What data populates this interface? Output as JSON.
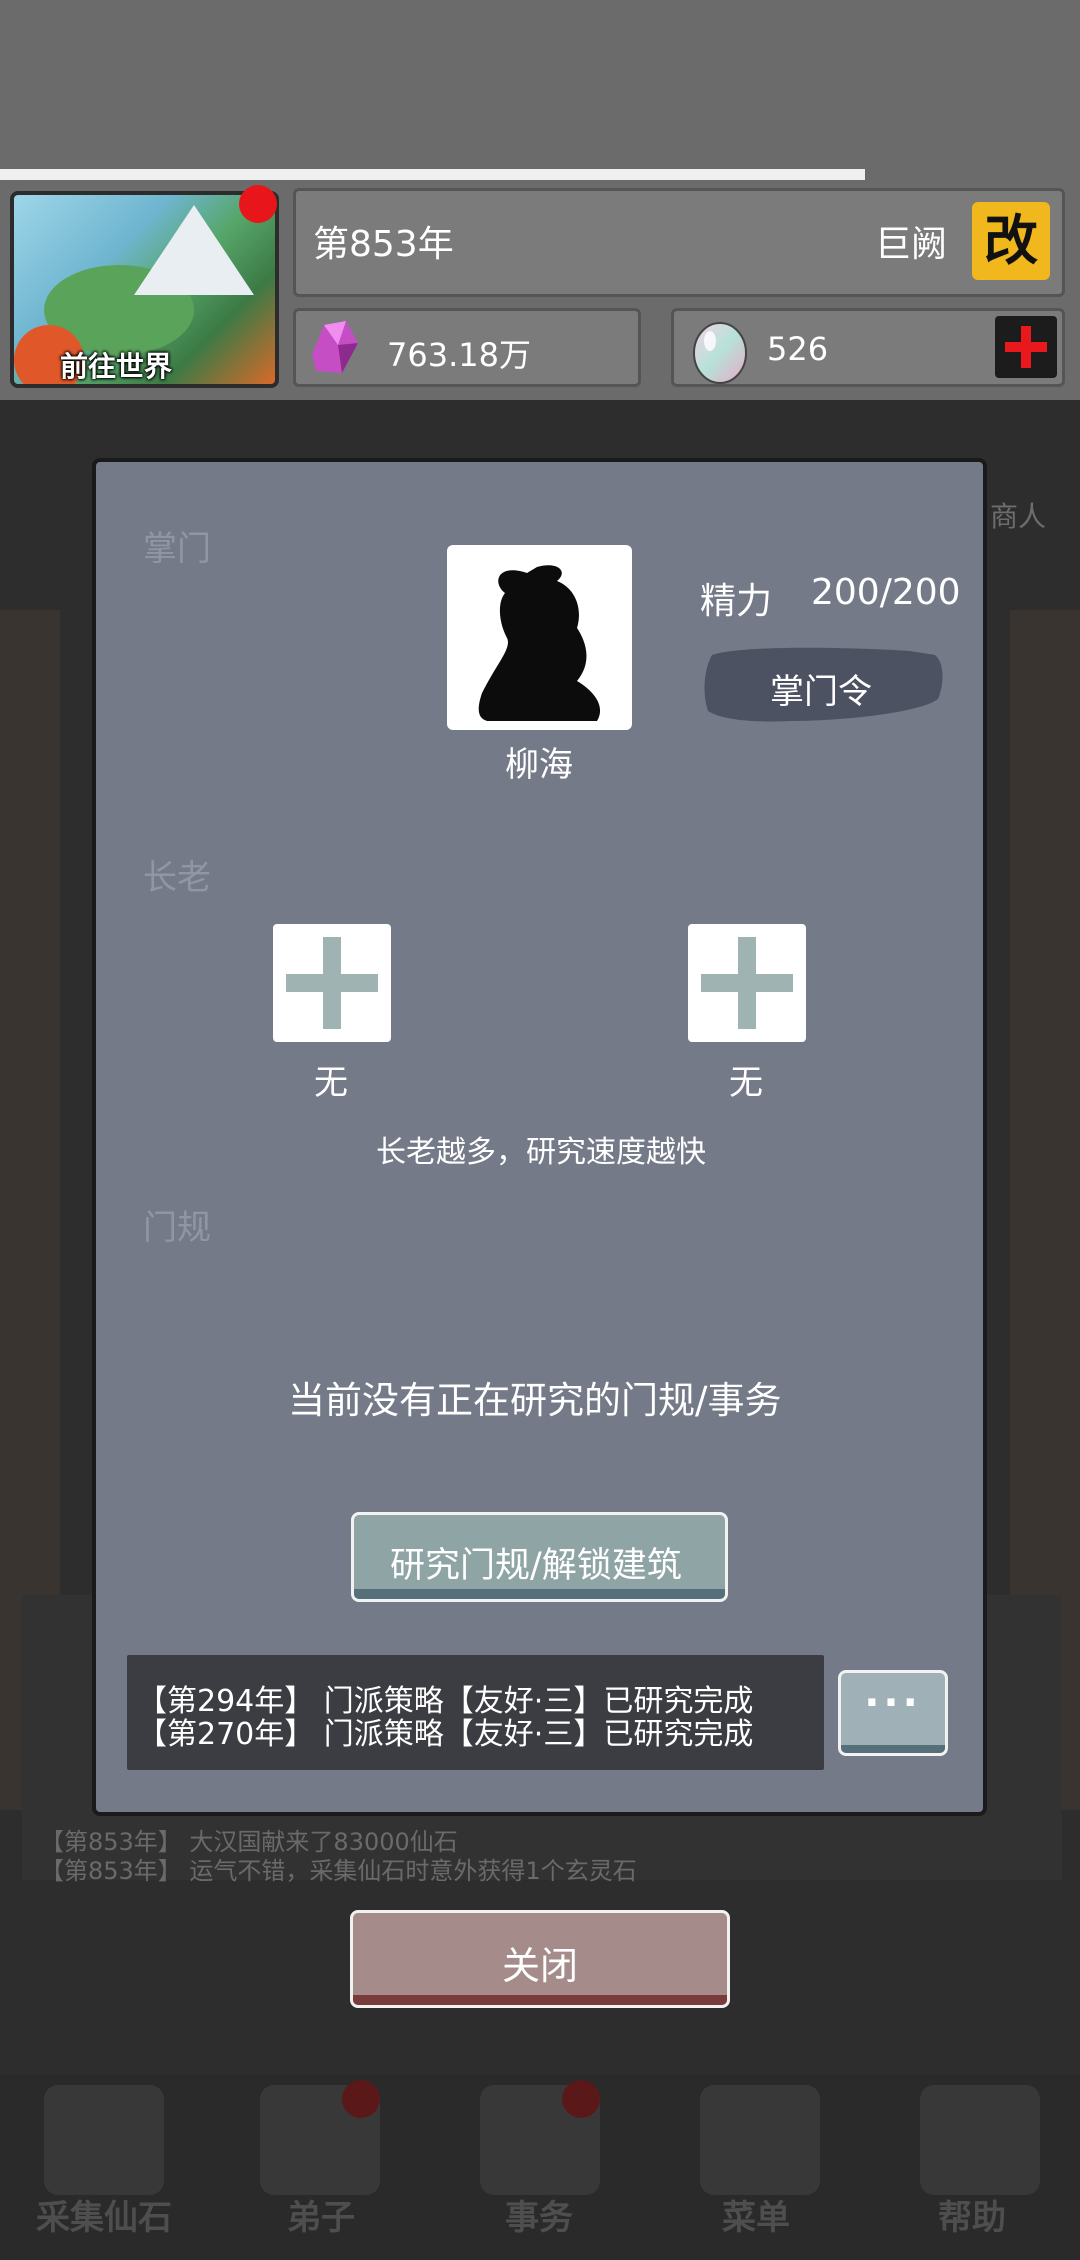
{
  "header": {
    "world_button_label": "前往世界",
    "year": "第853年",
    "sect_name": "巨阙",
    "rename_label": "改",
    "spirit_stone": "763.18万",
    "jade": "526"
  },
  "background": {
    "merchant_label": "商人",
    "log_lines": [
      "【第853年】 大汉国献来了83000仙石",
      "【第853年】 运气不错，采集仙石时意外获得1个玄灵石"
    ],
    "nav": [
      {
        "label": "采集仙石"
      },
      {
        "label": "弟子"
      },
      {
        "label": "事务"
      },
      {
        "label": "菜单"
      },
      {
        "label": "帮助"
      }
    ]
  },
  "dialog": {
    "leader_section": "掌门",
    "leader_name": "柳海",
    "energy_label": "精力",
    "energy_value": "200/200",
    "order_button": "掌门令",
    "elder_section": "长老",
    "elders": [
      {
        "name": "无"
      },
      {
        "name": "无"
      }
    ],
    "elder_hint": "长老越多，研究速度越快",
    "rules_section": "门规",
    "research_empty": "当前没有正在研究的门规/事务",
    "research_button": "研究门规/解锁建筑",
    "log": [
      "【第294年】 门派策略【友好·三】已研究完成",
      "【第270年】 门派策略【友好·三】已研究完成"
    ],
    "more_button": "···"
  },
  "close_button": "关闭"
}
